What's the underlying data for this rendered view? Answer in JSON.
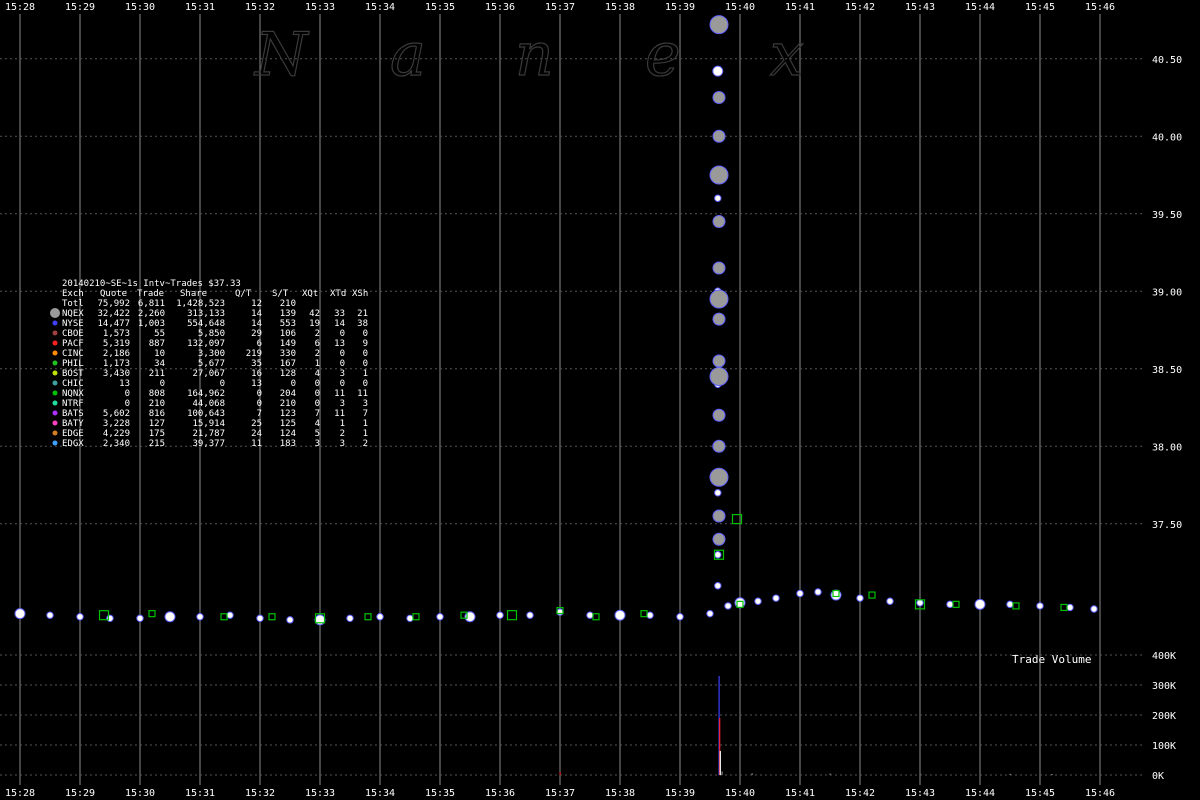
{
  "watermark": [
    "N",
    "a",
    "n",
    "e",
    "x"
  ],
  "colors": {
    "background": "#000000",
    "grid_vertical": "#8a8a8a",
    "grid_horizontal": "#555555",
    "text": "#ffffff",
    "quote_circle": "#9a9a9a",
    "quote_outline": "#6060ff",
    "trade_circle": "#ffffff",
    "trade_square": "#00c000",
    "volume": "#4040ff"
  },
  "table": {
    "title": "20140210~SE~1s Intv~Trades $37.33",
    "header": [
      "Exch",
      "Quote",
      "Trade",
      "Share",
      "Q/T",
      "S/T",
      "XQt",
      "XTd",
      "XSh"
    ],
    "rows": [
      {
        "exch": "Totl",
        "color": "",
        "quote": "75,992",
        "trade": "6,811",
        "share": "1,428,523",
        "qt": "12",
        "st": "210",
        "xqt": "",
        "xtd": "",
        "xsh": ""
      },
      {
        "exch": "NQEX",
        "color": "#9a9a9a",
        "quote": "32,422",
        "trade": "2,260",
        "share": "313,133",
        "qt": "14",
        "st": "139",
        "xqt": "42",
        "xtd": "33",
        "xsh": "21"
      },
      {
        "exch": "NYSE",
        "color": "#4040ff",
        "quote": "14,477",
        "trade": "1,003",
        "share": "554,648",
        "qt": "14",
        "st": "553",
        "xqt": "19",
        "xtd": "14",
        "xsh": "38"
      },
      {
        "exch": "CBOE",
        "color": "#a04040",
        "quote": "1,573",
        "trade": "55",
        "share": "5,850",
        "qt": "29",
        "st": "106",
        "xqt": "2",
        "xtd": "0",
        "xsh": "0"
      },
      {
        "exch": "PACF",
        "color": "#ff2020",
        "quote": "5,319",
        "trade": "887",
        "share": "132,097",
        "qt": "6",
        "st": "149",
        "xqt": "6",
        "xtd": "13",
        "xsh": "9"
      },
      {
        "exch": "CINC",
        "color": "#ff8c00",
        "quote": "2,186",
        "trade": "10",
        "share": "3,300",
        "qt": "219",
        "st": "330",
        "xqt": "2",
        "xtd": "0",
        "xsh": "0"
      },
      {
        "exch": "PHIL",
        "color": "#20c020",
        "quote": "1,173",
        "trade": "34",
        "share": "5,677",
        "qt": "35",
        "st": "167",
        "xqt": "1",
        "xtd": "0",
        "xsh": "0"
      },
      {
        "exch": "BOST",
        "color": "#c0e000",
        "quote": "3,430",
        "trade": "211",
        "share": "27,067",
        "qt": "16",
        "st": "128",
        "xqt": "4",
        "xtd": "3",
        "xsh": "1"
      },
      {
        "exch": "CHIC",
        "color": "#40a0a0",
        "quote": "13",
        "trade": "0",
        "share": "0",
        "qt": "13",
        "st": "0",
        "xqt": "0",
        "xtd": "0",
        "xsh": "0"
      },
      {
        "exch": "NQNX",
        "color": "#00c000",
        "quote": "0",
        "trade": "808",
        "share": "164,962",
        "qt": "0",
        "st": "204",
        "xqt": "0",
        "xtd": "11",
        "xsh": "11"
      },
      {
        "exch": "NTRF",
        "color": "#20e0a0",
        "quote": "0",
        "trade": "210",
        "share": "44,068",
        "qt": "0",
        "st": "210",
        "xqt": "0",
        "xtd": "3",
        "xsh": "3"
      },
      {
        "exch": "BATS",
        "color": "#b030ff",
        "quote": "5,602",
        "trade": "816",
        "share": "100,643",
        "qt": "7",
        "st": "123",
        "xqt": "7",
        "xtd": "11",
        "xsh": "7"
      },
      {
        "exch": "BATY",
        "color": "#ff40c0",
        "quote": "3,228",
        "trade": "127",
        "share": "15,914",
        "qt": "25",
        "st": "125",
        "xqt": "4",
        "xtd": "1",
        "xsh": "1"
      },
      {
        "exch": "EDGE",
        "color": "#d08020",
        "quote": "4,229",
        "trade": "175",
        "share": "21,787",
        "qt": "24",
        "st": "124",
        "xqt": "5",
        "xtd": "2",
        "xsh": "1"
      },
      {
        "exch": "EDGX",
        "color": "#40a0ff",
        "quote": "2,340",
        "trade": "215",
        "share": "39,377",
        "qt": "11",
        "st": "183",
        "xqt": "3",
        "xtd": "3",
        "xsh": "2"
      }
    ]
  },
  "chart_data": {
    "type": "scatter",
    "x_ticks": [
      "15:28",
      "15:29",
      "15:30",
      "15:31",
      "15:32",
      "15:33",
      "15:34",
      "15:35",
      "15:36",
      "15:37",
      "15:38",
      "15:39",
      "15:40",
      "15:41",
      "15:42",
      "15:43",
      "15:44",
      "15:45",
      "15:46"
    ],
    "x_range_minutes": [
      28,
      46
    ],
    "price_ticks": [
      "37.50",
      "38.00",
      "38.50",
      "39.00",
      "39.50",
      "40.00",
      "40.50"
    ],
    "price_range": [
      36.75,
      40.75
    ],
    "volume_label": "Trade Volume",
    "volume_ticks": [
      "0K",
      "100K",
      "200K",
      "300K",
      "400K"
    ],
    "volume_range": [
      0,
      400000
    ],
    "grid": true,
    "trades": [
      [
        28.0,
        36.92
      ],
      [
        28.5,
        36.91
      ],
      [
        29.0,
        36.9
      ],
      [
        29.5,
        36.89
      ],
      [
        30.0,
        36.89
      ],
      [
        30.5,
        36.9
      ],
      [
        31.0,
        36.9
      ],
      [
        31.5,
        36.91
      ],
      [
        32.0,
        36.89
      ],
      [
        32.5,
        36.88
      ],
      [
        33.0,
        36.88
      ],
      [
        33.5,
        36.89
      ],
      [
        34.0,
        36.9
      ],
      [
        34.5,
        36.89
      ],
      [
        35.0,
        36.9
      ],
      [
        35.5,
        36.9
      ],
      [
        36.0,
        36.91
      ],
      [
        36.5,
        36.91
      ],
      [
        37.0,
        36.93
      ],
      [
        37.5,
        36.91
      ],
      [
        38.0,
        36.91
      ],
      [
        38.5,
        36.91
      ],
      [
        39.0,
        36.9
      ],
      [
        39.5,
        36.92
      ],
      [
        39.63,
        40.75
      ],
      [
        39.63,
        40.42
      ],
      [
        39.63,
        40.0
      ],
      [
        39.63,
        39.6
      ],
      [
        39.63,
        39.0
      ],
      [
        39.63,
        38.4
      ],
      [
        39.63,
        38.0
      ],
      [
        39.63,
        37.7
      ],
      [
        39.63,
        37.3
      ],
      [
        39.63,
        37.1
      ],
      [
        39.8,
        36.97
      ],
      [
        40.0,
        36.99
      ],
      [
        40.3,
        37.0
      ],
      [
        40.6,
        37.02
      ],
      [
        41.0,
        37.05
      ],
      [
        41.3,
        37.06
      ],
      [
        41.6,
        37.04
      ],
      [
        42.0,
        37.02
      ],
      [
        42.5,
        37.0
      ],
      [
        43.0,
        36.99
      ],
      [
        43.5,
        36.98
      ],
      [
        44.0,
        36.98
      ],
      [
        44.5,
        36.98
      ],
      [
        45.0,
        36.97
      ],
      [
        45.5,
        36.96
      ],
      [
        45.9,
        36.95
      ]
    ],
    "nqnx_squares": [
      [
        29.4,
        36.91
      ],
      [
        30.2,
        36.92
      ],
      [
        31.4,
        36.9
      ],
      [
        32.2,
        36.9
      ],
      [
        33.0,
        36.89
      ],
      [
        33.8,
        36.9
      ],
      [
        34.6,
        36.9
      ],
      [
        35.4,
        36.91
      ],
      [
        36.2,
        36.91
      ],
      [
        37.0,
        36.94
      ],
      [
        37.6,
        36.9
      ],
      [
        38.4,
        36.92
      ],
      [
        39.65,
        37.3
      ],
      [
        40.0,
        36.98
      ],
      [
        41.6,
        37.05
      ],
      [
        42.2,
        37.04
      ],
      [
        43.0,
        36.98
      ],
      [
        43.6,
        36.98
      ],
      [
        44.6,
        36.97
      ],
      [
        45.4,
        36.96
      ],
      [
        39.95,
        37.53
      ]
    ],
    "spike_quotes": [
      [
        39.65,
        40.72
      ],
      [
        39.65,
        40.25
      ],
      [
        39.65,
        40.0
      ],
      [
        39.65,
        39.75
      ],
      [
        39.65,
        39.45
      ],
      [
        39.65,
        39.15
      ],
      [
        39.65,
        38.95
      ],
      [
        39.65,
        38.82
      ],
      [
        39.65,
        38.55
      ],
      [
        39.65,
        38.45
      ],
      [
        39.65,
        38.2
      ],
      [
        39.65,
        38.0
      ],
      [
        39.65,
        37.8
      ],
      [
        39.65,
        37.55
      ],
      [
        39.65,
        37.4
      ]
    ],
    "volume_bars": [
      {
        "x": 39.65,
        "v": 330000,
        "color": "#4040ff"
      },
      {
        "x": 39.66,
        "v": 190000,
        "color": "#ff2020"
      },
      {
        "x": 39.67,
        "v": 80000,
        "color": "#ffffff"
      },
      {
        "x": 39.7,
        "v": 12000,
        "color": "#888888"
      },
      {
        "x": 37.0,
        "v": 9000,
        "color": "#ff2020"
      },
      {
        "x": 40.2,
        "v": 6000,
        "color": "#888888"
      },
      {
        "x": 41.5,
        "v": 5000,
        "color": "#888888"
      },
      {
        "x": 43.0,
        "v": 4000,
        "color": "#888888"
      },
      {
        "x": 44.5,
        "v": 4000,
        "color": "#888888"
      },
      {
        "x": 45.2,
        "v": 3500,
        "color": "#888888"
      }
    ]
  }
}
